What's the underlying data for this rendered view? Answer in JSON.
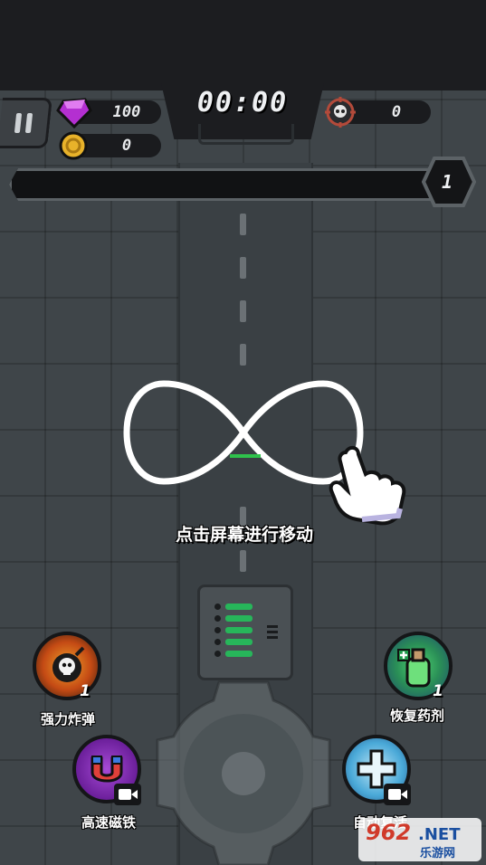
{
  "hud": {
    "timer": "00:00",
    "gems": "100",
    "coins": "0",
    "kills": "0",
    "level": "1",
    "progress": 0
  },
  "tutorial": {
    "hint": "点击屏幕进行移动"
  },
  "skills": {
    "bomb": {
      "label": "强力炸弹",
      "count": "1"
    },
    "potion": {
      "label": "恢复药剂",
      "count": "1"
    },
    "magnet": {
      "label": "高速磁铁"
    },
    "revive": {
      "label": "自动复活"
    }
  },
  "watermark": {
    "main": "962",
    "net": ".NET",
    "sub": "乐游网"
  },
  "colors": {
    "board": "#3f4549",
    "hud_dark": "#1c1d20",
    "gem": "#b42fd1",
    "coin": "#e8b22a",
    "terminal_green": "#27b65a",
    "magnet_ring": "#7a2ab0",
    "potion_ring": "#2fa85a"
  },
  "icons": [
    "pause-icon",
    "gem-icon",
    "coin-icon",
    "skull-target-icon",
    "infinity-gesture-icon",
    "pointing-hand-icon",
    "bomb-skull-icon",
    "potion-bottle-icon",
    "magnet-icon",
    "revive-cross-icon",
    "video-ad-icon"
  ]
}
